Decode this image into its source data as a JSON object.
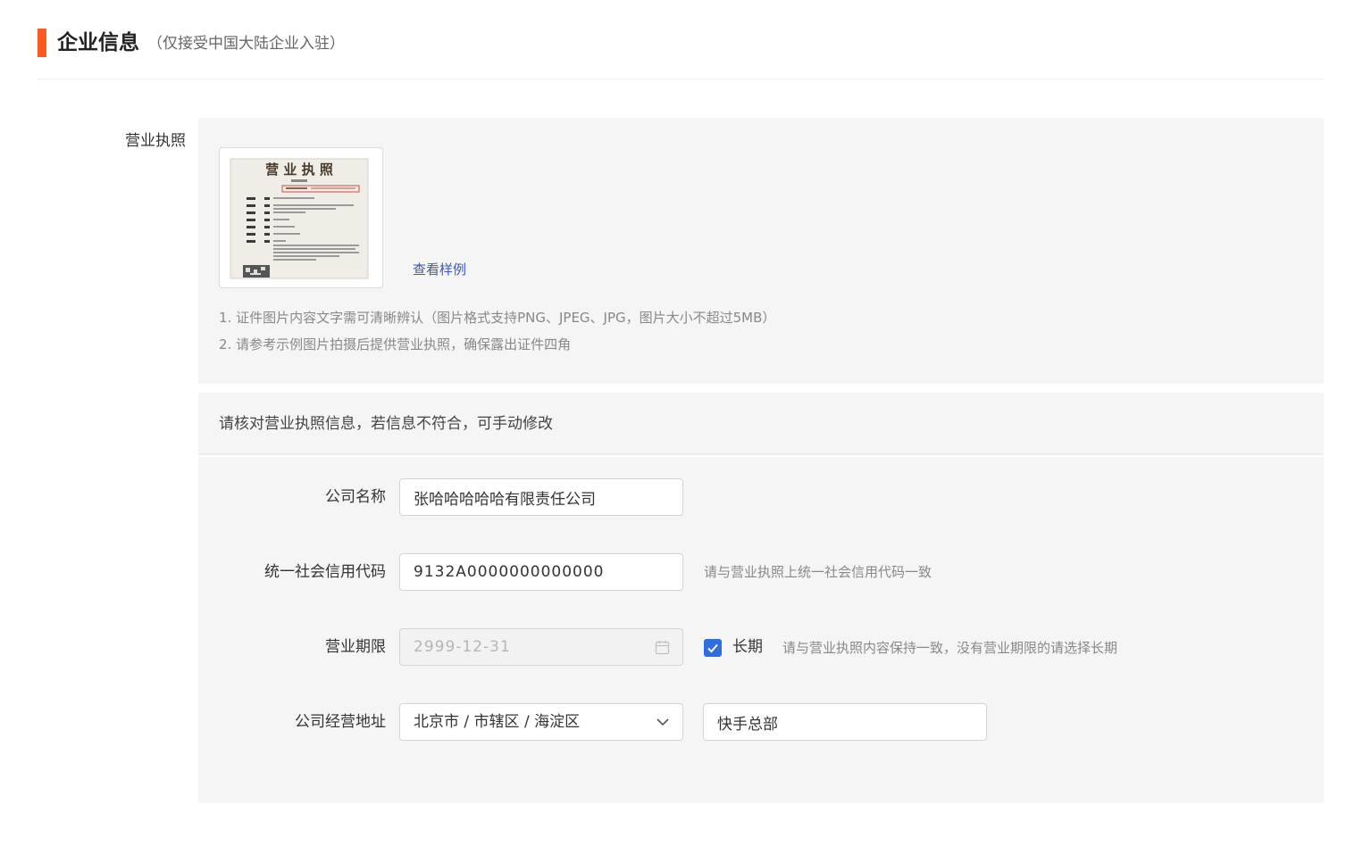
{
  "header": {
    "title": "企业信息",
    "subtitle": "（仅接受中国大陆企业入驻）"
  },
  "license": {
    "label": "营业执照",
    "sample_title": "营 业 执 照",
    "view_example": "查看样例",
    "tips": [
      "1. 证件图片内容文字需可清晰辨认（图片格式支持PNG、JPEG、JPG，图片大小不超过5MB）",
      "2. 请参考示例图片拍摄后提供营业执照，确保露出证件四角"
    ]
  },
  "verify": {
    "title": "请核对营业执照信息，若信息不符合，可手动修改",
    "company_name": {
      "label": "公司名称",
      "value": "张哈哈哈哈哈有限责任公司"
    },
    "credit_code": {
      "label": "统一社会信用代码",
      "value": "9132A0000000000000",
      "hint": "请与营业执照上统一社会信用代码一致"
    },
    "business_term": {
      "label": "营业期限",
      "value": "2999-12-31",
      "long_term_label": "长期",
      "long_term_checked": true,
      "hint": "请与营业执照内容保持一致，没有营业期限的请选择长期"
    },
    "address": {
      "label": "公司经营地址",
      "region": "北京市 / 市辖区 / 海淀区",
      "detail": "快手总部"
    }
  },
  "colors": {
    "accent": "#ff5a1f",
    "link": "#3a56c5",
    "checkbox": "#2f6ee0",
    "panel": "#f5f5f6"
  }
}
